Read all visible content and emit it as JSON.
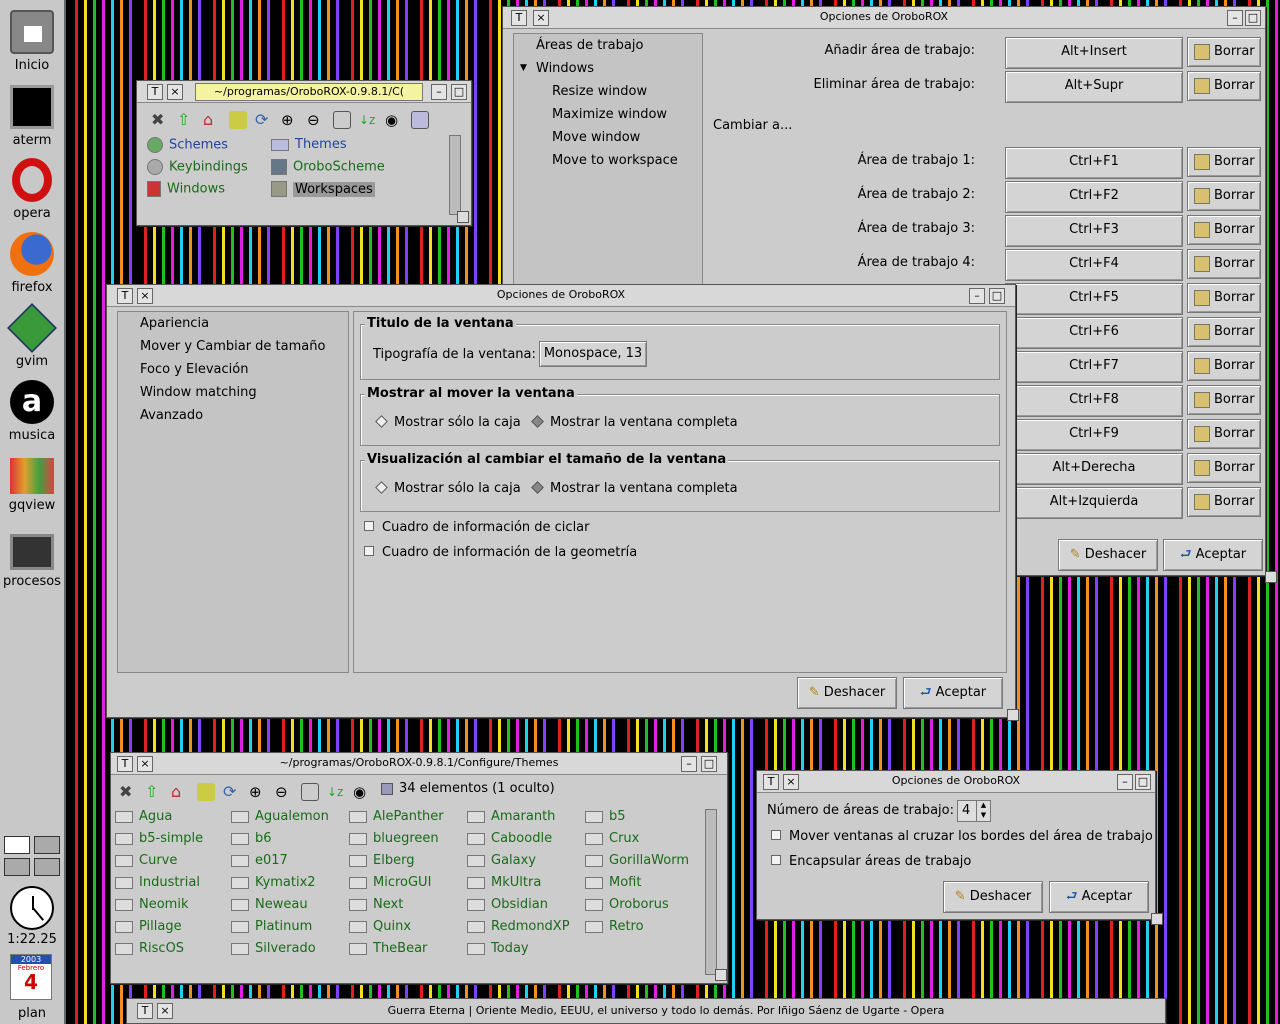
{
  "dock": {
    "items": [
      {
        "label": "Inicio",
        "icon": "home-icon"
      },
      {
        "label": "aterm",
        "icon": "terminal-icon"
      },
      {
        "label": "opera",
        "icon": "opera-icon"
      },
      {
        "label": "firefox",
        "icon": "firefox-icon"
      },
      {
        "label": "gvim",
        "icon": "gvim-icon"
      },
      {
        "label": "musica",
        "icon": "music-icon"
      },
      {
        "label": "gqview",
        "icon": "image-viewer-icon"
      },
      {
        "label": "procesos",
        "icon": "process-monitor-icon"
      }
    ],
    "clock_time": "1:22.25",
    "calendar": {
      "year": "2003",
      "month": "Febrero",
      "day": "4",
      "label": "plan"
    }
  },
  "filer_top": {
    "path": "~/programas/OroboROX-0.9.8.1/C(",
    "items": [
      {
        "label": "Schemes",
        "icon": "schemes-icon"
      },
      {
        "label": "Themes",
        "icon": "themes-icon"
      },
      {
        "label": "Keybindings",
        "icon": "keybindings-icon"
      },
      {
        "label": "OroboScheme",
        "icon": "oroboscheme-icon"
      },
      {
        "label": "Windows",
        "icon": "windows-icon"
      },
      {
        "label": "Workspaces",
        "icon": "workspaces-icon"
      }
    ]
  },
  "keys_win": {
    "title": "Opciones de OroboROX",
    "tree": {
      "areas": "Áreas de trabajo",
      "windows": "Windows",
      "children": [
        "Resize window",
        "Maximize window",
        "Move window",
        "Move to workspace"
      ]
    },
    "add": {
      "label": "Añadir área de trabajo:",
      "key": "Alt+Insert"
    },
    "remove": {
      "label": "Eliminar área de trabajo:",
      "key": "Alt+Supr"
    },
    "switch_heading": "Cambiar a...",
    "rows": [
      {
        "label": "Área de trabajo 1:",
        "key": "Ctrl+F1"
      },
      {
        "label": "Área de trabajo 2:",
        "key": "Ctrl+F2"
      },
      {
        "label": "Área de trabajo 3:",
        "key": "Ctrl+F3"
      },
      {
        "label": "Área de trabajo 4:",
        "key": "Ctrl+F4"
      },
      {
        "label": "",
        "key": "Ctrl+F5"
      },
      {
        "label": "",
        "key": "Ctrl+F6"
      },
      {
        "label": "",
        "key": "Ctrl+F7"
      },
      {
        "label": "",
        "key": "Ctrl+F8"
      },
      {
        "label": "",
        "key": "Ctrl+F9"
      },
      {
        "label": "",
        "key": "Alt+Derecha"
      },
      {
        "label": "",
        "key": "Alt+Izquierda"
      }
    ],
    "delete_label": "Borrar",
    "undo_label": "Deshacer",
    "accept_label": "Aceptar"
  },
  "main_win": {
    "title": "Opciones de OroboROX",
    "sections": [
      "Apariencia",
      "Mover y Cambiar de tamaño",
      "Foco y Elevación",
      "Window matching",
      "Avanzado"
    ],
    "title_frame": {
      "legend": "Titulo de la ventana",
      "font_label": "Tipografía de la ventana:",
      "font_value": "Monospace, 13"
    },
    "move_frame": {
      "legend": "Mostrar al mover la ventana",
      "opt1": "Mostrar sólo la caja",
      "opt2": "Mostrar la ventana completa"
    },
    "resize_frame": {
      "legend": "Visualización al cambiar el tamaño de la ventana",
      "opt1": "Mostrar sólo la caja",
      "opt2": "Mostrar la ventana completa"
    },
    "check1": "Cuadro de información de ciclar",
    "check2": "Cuadro de información de la geometría",
    "undo_label": "Deshacer",
    "accept_label": "Aceptar"
  },
  "themes_win": {
    "path": "~/programas/OroboROX-0.9.8.1/Configure/Themes",
    "count": "34 elementos (1 oculto)",
    "items": [
      "Agua",
      "Agualemon",
      "AlePanther",
      "Amaranth",
      "b5",
      "b5-simple",
      "b6",
      "bluegreen",
      "Caboodle",
      "Crux",
      "Curve",
      "e017",
      "Elberg",
      "Galaxy",
      "GorillaWorm",
      "Industrial",
      "Kymatix2",
      "MicroGUI",
      "MkUltra",
      "Mofit",
      "Neomik",
      "Neweau",
      "Next",
      "Obsidian",
      "Oroborus",
      "Pillage",
      "Platinum",
      "Quinx",
      "RedmondXP",
      "Retro",
      "RiscOS",
      "Silverado",
      "TheBear",
      "Today"
    ]
  },
  "ws_win": {
    "title": "Opciones de OroboROX",
    "count_label": "Número de áreas de trabajo:",
    "count_value": "4",
    "check1": "Mover ventanas al cruzar los bordes del área de trabajo",
    "check2": "Encapsular áreas de trabajo",
    "undo_label": "Deshacer",
    "accept_label": "Aceptar"
  },
  "taskbar": {
    "title": "Guerra Eterna | Oriente Medio, EEUU, el universo y todo lo demás. Por Iñigo Sáenz de Ugarte - Opera"
  }
}
